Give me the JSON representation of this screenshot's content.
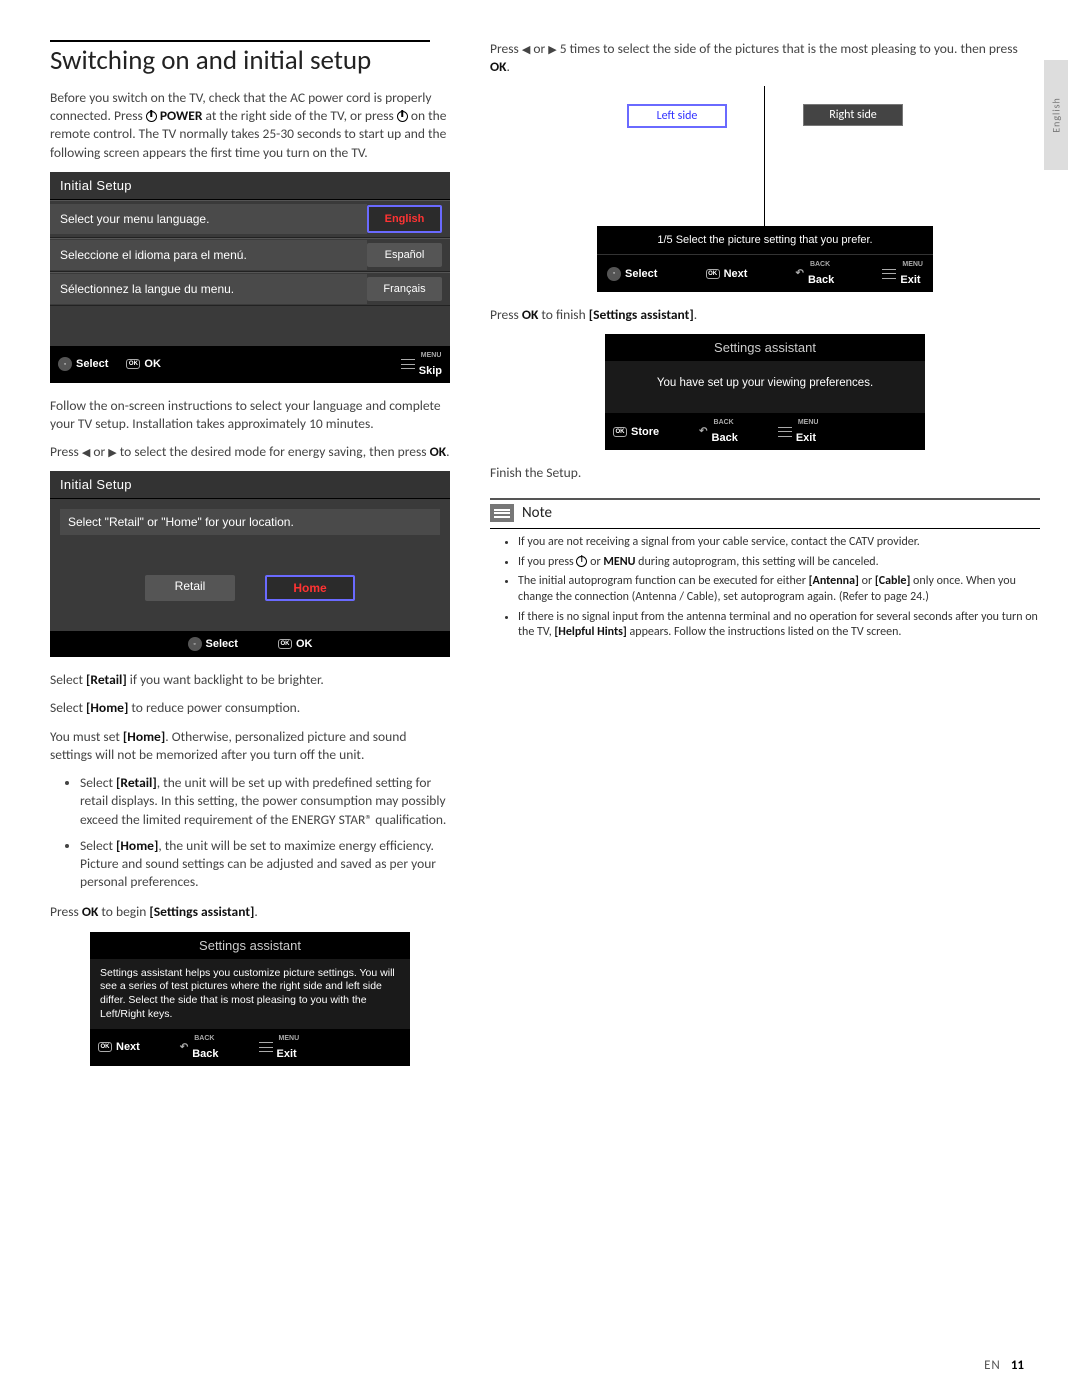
{
  "page": {
    "lang_tab": "English",
    "footer_lang": "EN",
    "footer_page": "11"
  },
  "heading": "Switching on and initial setup",
  "intro": {
    "p1a": "Before you switch on the TV, check that the AC power cord is properly connected. Press ",
    "power_label": "POWER",
    "p1b": " at the right side of the TV, or press ",
    "p1c": " on the remote control. The TV normally takes 25-30 seconds to start up and the following screen appears the ﬁrst time you turn on the TV."
  },
  "osd1": {
    "title": "Initial Setup",
    "rows": [
      {
        "label": "Select your menu language.",
        "opt": "English",
        "selected": true
      },
      {
        "label": "Seleccione el idioma para el menú.",
        "opt": "Español",
        "selected": false
      },
      {
        "label": "Sélectionnez la langue du menu.",
        "opt": "Français",
        "selected": false
      }
    ],
    "footer": {
      "select": "Select",
      "ok": "OK",
      "skip": "Skip",
      "menu_sup": "MENU"
    }
  },
  "after1": "Follow the on-screen instructions to select your language and complete your TV setup. Installation takes approximately 10 minutes.",
  "energy_prompt_a": "Press ",
  "energy_prompt_b": " or ",
  "energy_prompt_c": " to select the desired mode for energy saving, then press ",
  "energy_prompt_ok": "OK",
  "energy_prompt_d": ".",
  "osd2": {
    "title": "Initial Setup",
    "prompt": "Select \"Retail\" or \"Home\" for your location.",
    "retail": "Retail",
    "home": "Home",
    "footer": {
      "select": "Select",
      "ok": "OK"
    }
  },
  "loc_text": {
    "l1a": "Select ",
    "l1b": "[Retail]",
    "l1c": " if you want backlight to be brighter.",
    "l2a": "Select ",
    "l2b": "[Home]",
    "l2c": " to reduce power consumption.",
    "l3a": "You must set ",
    "l3b": "[Home]",
    "l3c": ". Otherwise, personalized picture and sound settings will not be memorized after you turn off the unit."
  },
  "bullets": [
    {
      "a": "Select ",
      "b": "[Retail]",
      "c": ", the unit will be set up with predeﬁned setting for retail displays. In this setting, the power consumption may possibly exceed the limited requirement of the ENERGY STAR® qualiﬁcation."
    },
    {
      "a": "Select ",
      "b": "[Home]",
      "c": ", the unit will be set to maximize energy efﬁciency. Picture and sound settings can be adjusted and saved as per your personal preferences."
    }
  ],
  "begin_sa_a": "Press ",
  "begin_sa_ok": "OK",
  "begin_sa_b": " to begin ",
  "begin_sa_c": "[Settings assistant]",
  "begin_sa_d": ".",
  "osd_sa1": {
    "title": "Settings assistant",
    "body": "Settings assistant helps you customize picture settings. You will see a series of test pictures where the right side and left side differ. Select the side that is most pleasing to you with the Left/Right keys.",
    "footer": {
      "next": "Next",
      "back": "Back",
      "exit": "Exit",
      "back_sup": "BACK",
      "menu_sup": "MENU"
    }
  },
  "right": {
    "p1a": "Press ",
    "p1b": " or ",
    "p1c": " 5 times to select the side of the pictures that is the most pleasing to you. then press ",
    "p1ok": "OK",
    "p1d": ".",
    "left_label": "Left side",
    "right_label": "Right side",
    "pic_msg": "1/5 Select the picture setting that you prefer.",
    "pic_footer": {
      "select": "Select",
      "next": "Next",
      "back": "Back",
      "exit": "Exit",
      "back_sup": "BACK",
      "menu_sup": "MENU"
    },
    "finish_a": "Press ",
    "finish_ok": "OK",
    "finish_b": " to ﬁnish ",
    "finish_c": "[Settings assistant]",
    "finish_d": ".",
    "osd_sa2": {
      "title": "Settings assistant",
      "body": "You have set up your viewing preferences.",
      "footer": {
        "store": "Store",
        "back": "Back",
        "exit": "Exit",
        "back_sup": "BACK",
        "menu_sup": "MENU"
      }
    },
    "finish_setup": "Finish the Setup.",
    "note_label": "Note",
    "notes": [
      "If you are not receiving a signal from your cable service, contact the CATV provider.",
      {
        "a": "If you press ",
        "b": " or ",
        "menu": "MENU",
        "c": " during autoprogram, this setting will be canceled."
      },
      {
        "a": "The initial autoprogram function can be executed for either ",
        "ant": "[Antenna]",
        "b": " or ",
        "cab": "[Cable]",
        "c": " only once. When you change the connection (Antenna / Cable), set autoprogram again. (Refer to page 24.)"
      },
      {
        "a": "If there is no signal input from the antenna terminal and no operation for several seconds after you turn on the TV, ",
        "hh": "[Helpful Hints]",
        "b": " appears. Follow the instructions listed on the TV screen."
      }
    ]
  }
}
